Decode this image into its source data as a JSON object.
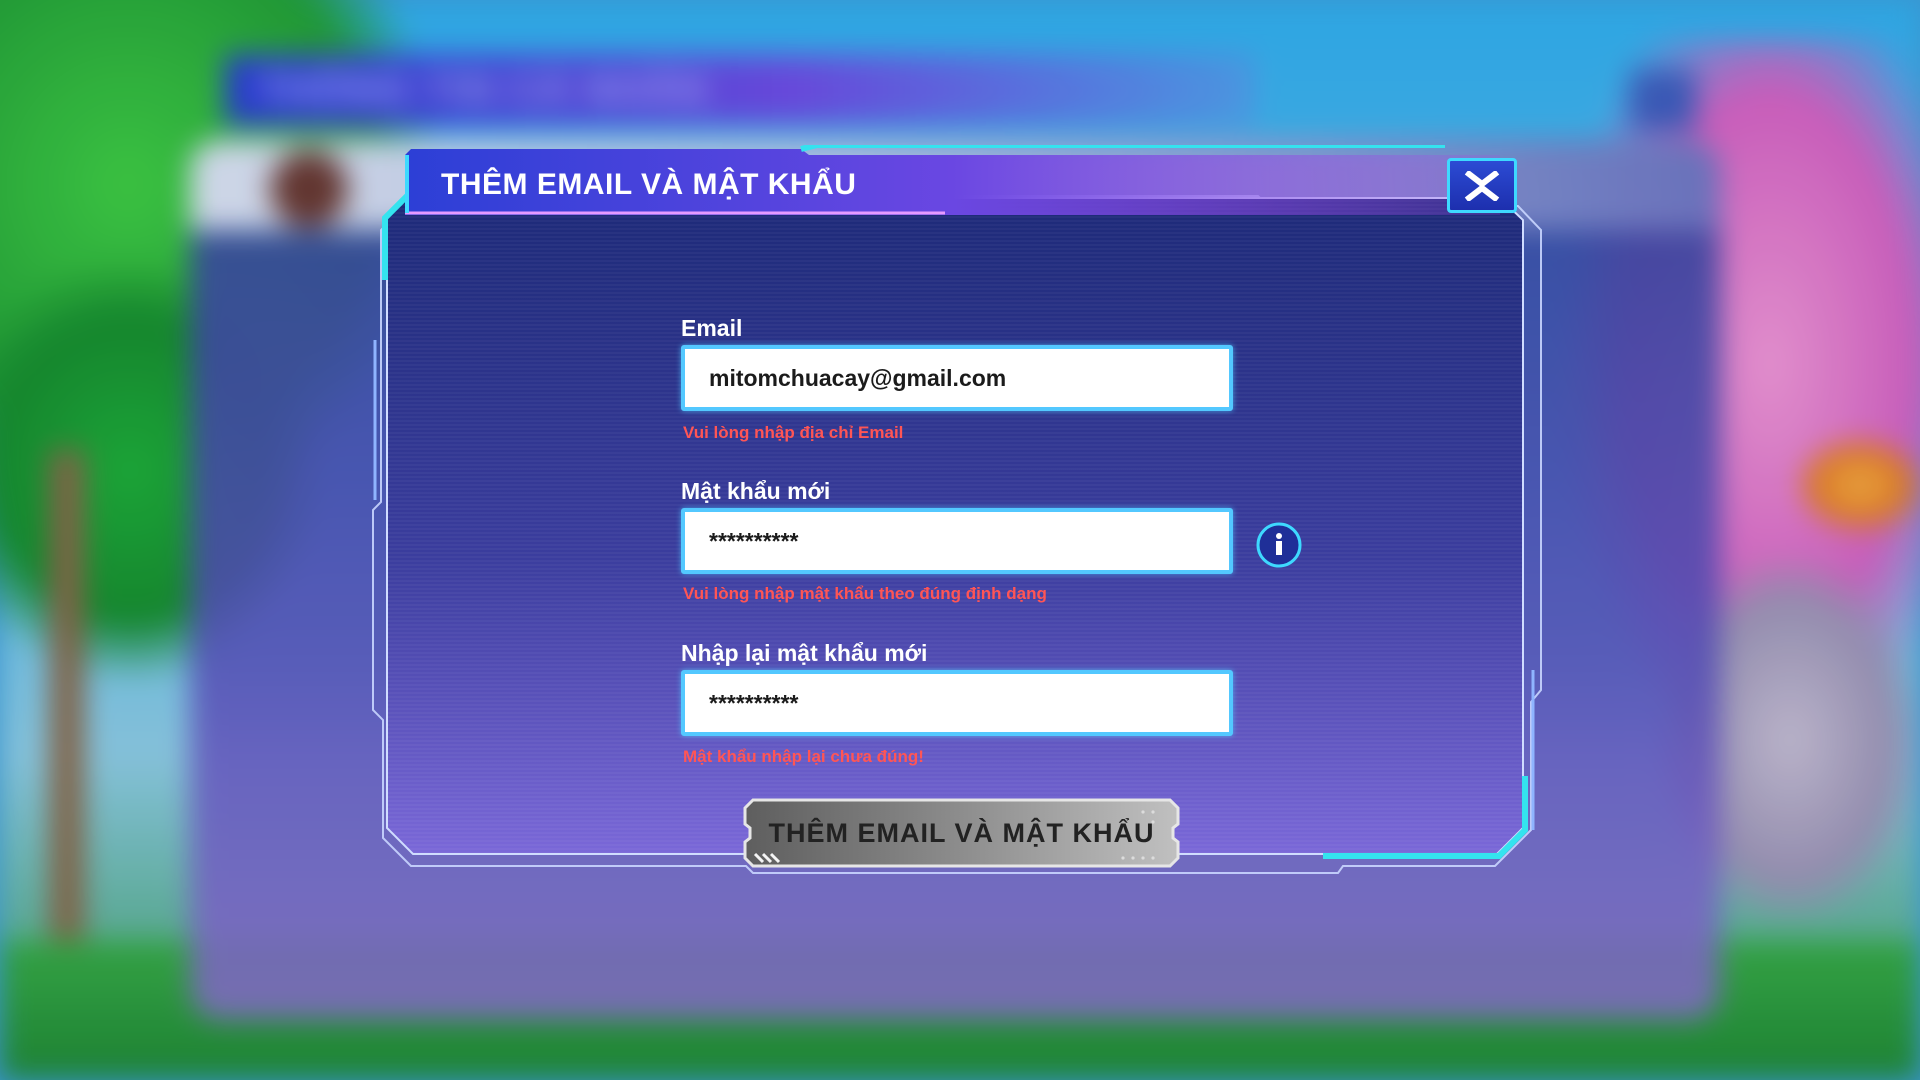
{
  "background": {
    "panel_title": "THÔNG TIN CÁ NHÂN"
  },
  "dialog": {
    "title": "THÊM EMAIL VÀ MẬT KHẨU",
    "close_icon": "close-x-icon",
    "email": {
      "label": "Email",
      "value": "mitomchuacay@gmail.com",
      "error": "Vui lòng nhập địa chỉ Email"
    },
    "new_password": {
      "label": "Mật khẩu mới",
      "value": "**********",
      "error": "Vui lòng nhập mật khẩu theo đúng định dạng",
      "info_icon": "info-icon"
    },
    "confirm_password": {
      "label": "Nhập lại mật khẩu mới",
      "value": "**********",
      "error": "Mật khẩu nhập lại chưa đúng!"
    },
    "submit_label": "THÊM EMAIL VÀ MẬT KHẨU"
  },
  "colors": {
    "frame_accent": "#34e3ef",
    "panel_top": "#1d2a78",
    "panel_bottom": "#7a68d8",
    "error": "#ff5555",
    "input_border": "#53c8ff",
    "header_start": "#2c3fd6",
    "header_end": "#a74be6",
    "button_disabled": "#8d8d8d"
  }
}
